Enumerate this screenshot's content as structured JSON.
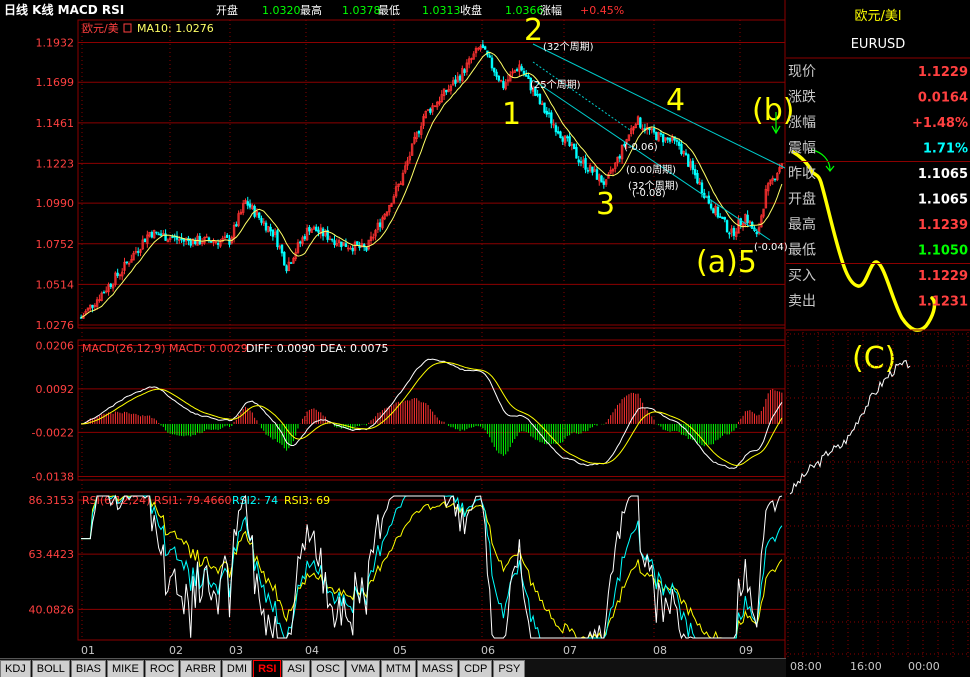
{
  "header": {
    "title": "日线 K线 MACD RSI",
    "fields": [
      {
        "label": "开盘",
        "value": "1.0320"
      },
      {
        "label": "最高",
        "value": "1.0378"
      },
      {
        "label": "最低",
        "value": "1.0313"
      },
      {
        "label": "收盘",
        "value": "1.0366"
      },
      {
        "label": "涨幅",
        "value": "+0.45%"
      }
    ]
  },
  "colors": {
    "up": "#ff3232",
    "down": "#00ffff",
    "ma": "#ffff66",
    "grid": "#8b0000",
    "macd_diff": "#ffffff",
    "macd_dea": "#ffff00",
    "rsi1": "#ffffff",
    "rsi2": "#00ffff",
    "rsi3": "#ffff00",
    "annotation": "#ffff00",
    "channel": "#00cccc",
    "green_arrow": "#00ff00"
  },
  "price_panel": {
    "legend_name": "欧元/美",
    "legend_ma": "MA10: 1.0276",
    "y_ticks": [
      "1.1932",
      "1.1699",
      "1.1461",
      "1.1223",
      "1.0990",
      "1.0752",
      "1.0514",
      "1.0276"
    ],
    "period_labels": [
      "(32个周期)",
      "(25个周期)",
      "(-0.06)",
      "(0.00周期)",
      "(32个周期)",
      "(-0.08)",
      "(-0.04)"
    ]
  },
  "macd_panel": {
    "legend": "MACD(26,12,9) MACD: 0.0029",
    "diff": "DIFF: 0.0090",
    "dea": "DEA: 0.0075",
    "y_ticks": [
      "0.0206",
      "0.0092",
      "-0.0022",
      "-0.0138"
    ]
  },
  "rsi_panel": {
    "legend": "RSI(6,12,24) RSI1: 79.4660",
    "rsi2": "RSI2: 74",
    "rsi3": "RSI3: 69",
    "y_ticks": [
      "86.3153",
      "63.4423",
      "40.0826"
    ]
  },
  "x_labels": [
    "01",
    "02",
    "03",
    "04",
    "05",
    "06",
    "07",
    "08",
    "09"
  ],
  "wave_labels": [
    "1",
    "2",
    "3",
    "4",
    "(a)5",
    "(b)",
    "(C)"
  ],
  "quote_panel": {
    "name": "欧元/美l",
    "code": "EURUSD",
    "rows": [
      {
        "label": "现价",
        "value": "1.1229",
        "color": "#ff4040"
      },
      {
        "label": "涨跌",
        "value": "0.0164",
        "color": "#ff4040"
      },
      {
        "label": "涨幅",
        "value": "+1.48%",
        "color": "#ff4040"
      },
      {
        "label": "震幅",
        "value": "1.71%",
        "color": "#00ffff"
      },
      {
        "label": "昨收",
        "value": "1.1065",
        "color": "#ffffff"
      },
      {
        "label": "开盘",
        "value": "1.1065",
        "color": "#ffffff"
      },
      {
        "label": "最高",
        "value": "1.1239",
        "color": "#ff4040"
      },
      {
        "label": "最低",
        "value": "1.1050",
        "color": "#00ff00"
      },
      {
        "label": "买入",
        "value": "1.1229",
        "color": "#ff4040"
      },
      {
        "label": "卖出",
        "value": "1.1231",
        "color": "#ff4040"
      }
    ],
    "intraday_x_labels": [
      "08:00",
      "16:00",
      "00:00"
    ]
  },
  "tabs": [
    "KDJ",
    "BOLL",
    "BIAS",
    "MIKE",
    "ROC",
    "ARBR",
    "DMI",
    "RSI",
    "ASI",
    "OSC",
    "VMA",
    "MTM",
    "MASS",
    "CDP",
    "PSY"
  ],
  "active_tab": "RSI",
  "chart_data": {
    "type": "candlestick",
    "price_axis": {
      "ticks": [
        1.1932,
        1.1699,
        1.1461,
        1.1223,
        1.099,
        1.0752,
        1.0514,
        1.0276
      ],
      "range": [
        1.027,
        1.197
      ]
    },
    "price_path_keypoints": [
      [
        0,
        1.032
      ],
      [
        18,
        1.06
      ],
      [
        30,
        1.082
      ],
      [
        45,
        1.077
      ],
      [
        65,
        1.077
      ],
      [
        72,
        1.1
      ],
      [
        85,
        1.08
      ],
      [
        90,
        1.062
      ],
      [
        100,
        1.085
      ],
      [
        115,
        1.075
      ],
      [
        125,
        1.072
      ],
      [
        140,
        1.112
      ],
      [
        150,
        1.15
      ],
      [
        165,
        1.172
      ],
      [
        175,
        1.191
      ],
      [
        185,
        1.168
      ],
      [
        192,
        1.18
      ],
      [
        202,
        1.155
      ],
      [
        218,
        1.125
      ],
      [
        230,
        1.11
      ],
      [
        243,
        1.148
      ],
      [
        250,
        1.14
      ],
      [
        262,
        1.133
      ],
      [
        275,
        1.1
      ],
      [
        285,
        1.081
      ],
      [
        291,
        1.092
      ],
      [
        296,
        1.079
      ],
      [
        300,
        1.105
      ],
      [
        307,
        1.123
      ]
    ],
    "candle_count": 308,
    "ma": "MA10",
    "macd": {
      "axis_ticks": [
        0.0206,
        0.0092,
        -0.0022,
        -0.0138
      ],
      "range": [
        -0.0142,
        0.021
      ]
    },
    "rsi": {
      "axis_ticks": [
        86.3153,
        63.4423,
        40.0826
      ],
      "range": [
        28,
        88
      ]
    },
    "intraday_points": [
      [
        0,
        1.106
      ],
      [
        0.08,
        1.1075
      ],
      [
        0.16,
        1.109
      ],
      [
        0.25,
        1.11
      ],
      [
        0.33,
        1.1115
      ],
      [
        0.42,
        1.112
      ],
      [
        0.5,
        1.1135
      ],
      [
        0.58,
        1.116
      ],
      [
        0.66,
        1.118
      ],
      [
        0.75,
        1.12
      ],
      [
        0.83,
        1.1215
      ],
      [
        0.9,
        1.1225
      ],
      [
        1,
        1.1229
      ]
    ]
  }
}
